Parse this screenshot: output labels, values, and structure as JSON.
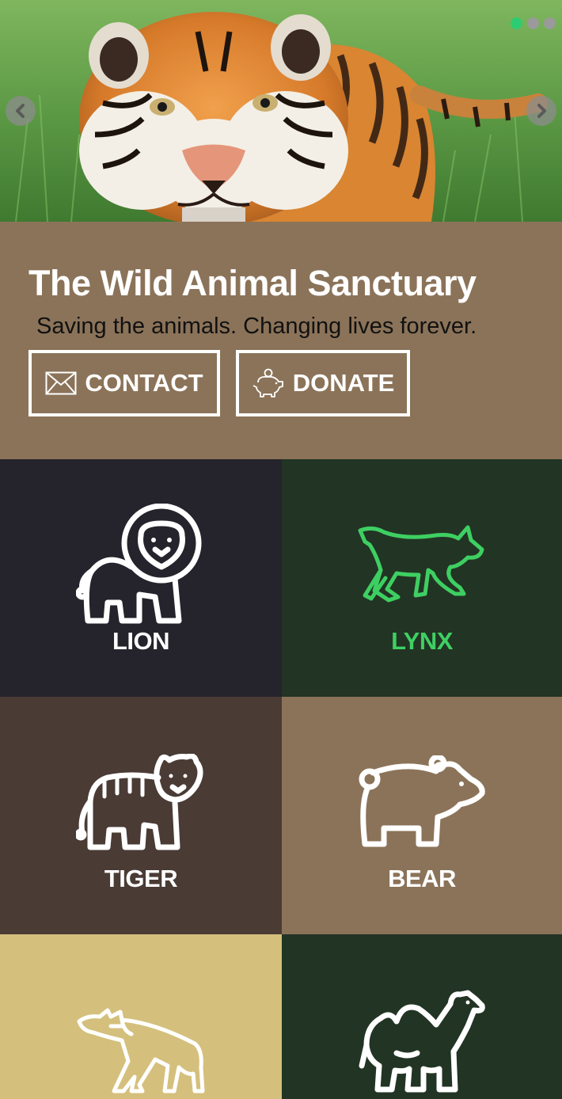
{
  "hero": {
    "slides": 3,
    "active_slide": 1,
    "image": "tiger-photo",
    "prev_icon": "chevron-left-icon",
    "next_icon": "chevron-right-icon"
  },
  "info": {
    "title": "The Wild Animal Sanctuary",
    "tagline": "Saving the animals. Changing lives forever.",
    "contact_label": "CONTACT",
    "contact_icon": "envelope-icon",
    "donate_label": "DONATE",
    "donate_icon": "piggy-bank-icon"
  },
  "animals": [
    {
      "label": "LION",
      "icon": "lion-icon",
      "bg": "#25242c",
      "color": "#ffffff"
    },
    {
      "label": "LYNX",
      "icon": "lynx-icon",
      "bg": "#223424",
      "color": "#3ecf62"
    },
    {
      "label": "TIGER",
      "icon": "tiger-icon",
      "bg": "#4a3b35",
      "color": "#ffffff"
    },
    {
      "label": "BEAR",
      "icon": "bear-icon",
      "bg": "#8b7359",
      "color": "#ffffff"
    },
    {
      "label": "",
      "icon": "hyena-icon",
      "bg": "#d4c07c",
      "color": "#ffffff"
    },
    {
      "label": "",
      "icon": "camel-icon",
      "bg": "#223424",
      "color": "#ffffff"
    }
  ],
  "colors": {
    "accent_green": "#2ecc71",
    "brown": "#8b7359"
  }
}
